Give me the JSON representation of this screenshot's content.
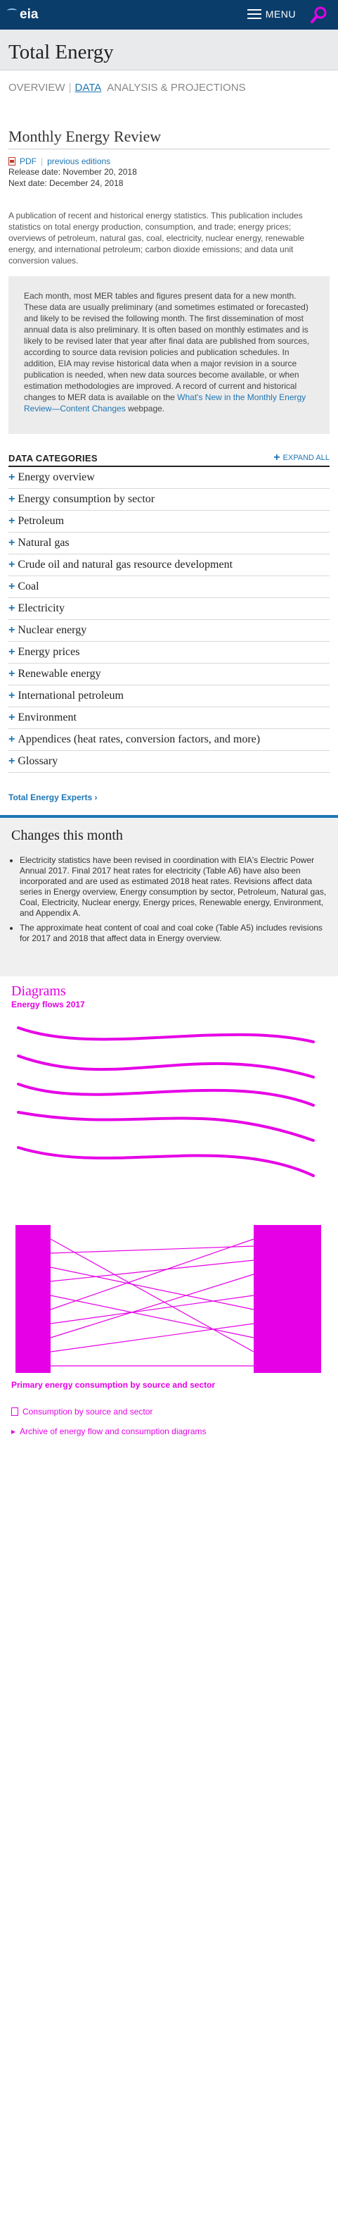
{
  "header": {
    "logo_text": "eia",
    "menu_label": "MENU"
  },
  "title_band": {
    "title": "Total Energy"
  },
  "subnav": {
    "items": [
      "OVERVIEW",
      "DATA",
      "ANALYSIS & PROJECTIONS"
    ],
    "active_index": 1
  },
  "page": {
    "heading": "Monthly Energy Review",
    "pdf_label": "PDF",
    "previous_editions_label": "previous editions",
    "release_date": "Release date: November 20, 2018",
    "next_date": "Next date: December 24, 2018",
    "lede": "A publication of recent and historical energy statistics. This publication includes statistics on total energy production, consumption, and trade; energy prices; overviews of petroleum, natural gas, coal, electricity, nuclear energy, renewable energy, and international petroleum; carbon dioxide emissions; and data unit conversion values."
  },
  "notice": {
    "text": "Each month, most MER tables and figures present data for a new month. These data are usually preliminary (and sometimes estimated or forecasted) and likely to be revised the following month. The first dissemination of most annual data is also preliminary. It is often based on monthly estimates and is likely to be revised later that year after final data are published from sources, according to source data revision policies and publication schedules. In addition, EIA may revise historical data when a major revision in a source publication is needed, when new data sources become available, or when estimation methodologies are improved. A record of current and historical changes to MER data is available on the ",
    "link_text": "What's New in the Monthly Energy Review—Content Changes",
    "suffix": " webpage."
  },
  "categories": {
    "heading": "DATA CATEGORIES",
    "expand_label": "EXPAND ALL",
    "items": [
      "Energy overview",
      "Energy consumption by sector",
      "Petroleum",
      "Natural gas",
      "Crude oil and natural gas resource development",
      "Coal",
      "Electricity",
      "Nuclear energy",
      "Energy prices",
      "Renewable energy",
      "International petroleum",
      "Environment",
      "Appendices (heat rates, conversion factors, and more)",
      "Glossary"
    ]
  },
  "experts_link": "Total Energy Experts ›",
  "changes": {
    "heading": "Changes this month",
    "items": [
      "Electricity statistics have been revised in coordination with EIA's Electric Power Annual 2017. Final 2017 heat rates for electricity (Table A6) have also been incorporated and are used as estimated 2018 heat rates. Revisions affect data series in Energy overview, Energy consumption by sector, Petroleum, Natural gas, Coal, Electricity, Nuclear energy, Energy prices, Renewable energy, Environment, and Appendix A.",
      "The approximate heat content of coal and coal coke (Table A5) includes revisions for 2017 and 2018 that affect data in Energy overview."
    ]
  },
  "diagrams": {
    "heading": "Diagrams",
    "label_1": "Energy flows 2017",
    "label_2": "Primary energy consumption by source and sector"
  },
  "footer_links": {
    "consumption_link": "Consumption by source and sector",
    "archive_link": "Archive of energy flow and consumption diagrams"
  },
  "colors": {
    "brand_navy": "#0b3d6b",
    "link_blue": "#1e76b4",
    "artifact_magenta": "#e600e6"
  }
}
